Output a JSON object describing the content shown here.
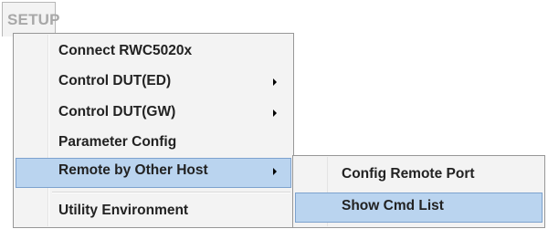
{
  "menubar": {
    "tab_label": "SETUP"
  },
  "setup_menu": {
    "items": [
      {
        "label": "Connect RWC5020x",
        "has_submenu": false
      },
      {
        "label": "Control DUT(ED)",
        "has_submenu": true
      },
      {
        "label": "Control DUT(GW)",
        "has_submenu": true
      },
      {
        "label": "Parameter Config",
        "has_submenu": false
      },
      {
        "label": "Remote by Other Host",
        "has_submenu": true,
        "highlighted": true
      },
      {
        "label": "Utility Environment",
        "has_submenu": false
      }
    ]
  },
  "remote_submenu": {
    "items": [
      {
        "label": "Config Remote Port"
      },
      {
        "label": "Show Cmd List",
        "highlighted": true
      }
    ]
  },
  "colors": {
    "menu_background": "#f3f3f3",
    "highlight_fill": "#bad4ef",
    "highlight_border": "#7da2ce",
    "menu_border": "#979797",
    "tab_text": "#a8a8a8"
  },
  "icons": {
    "submenu_arrow": "submenu-arrow-icon"
  }
}
